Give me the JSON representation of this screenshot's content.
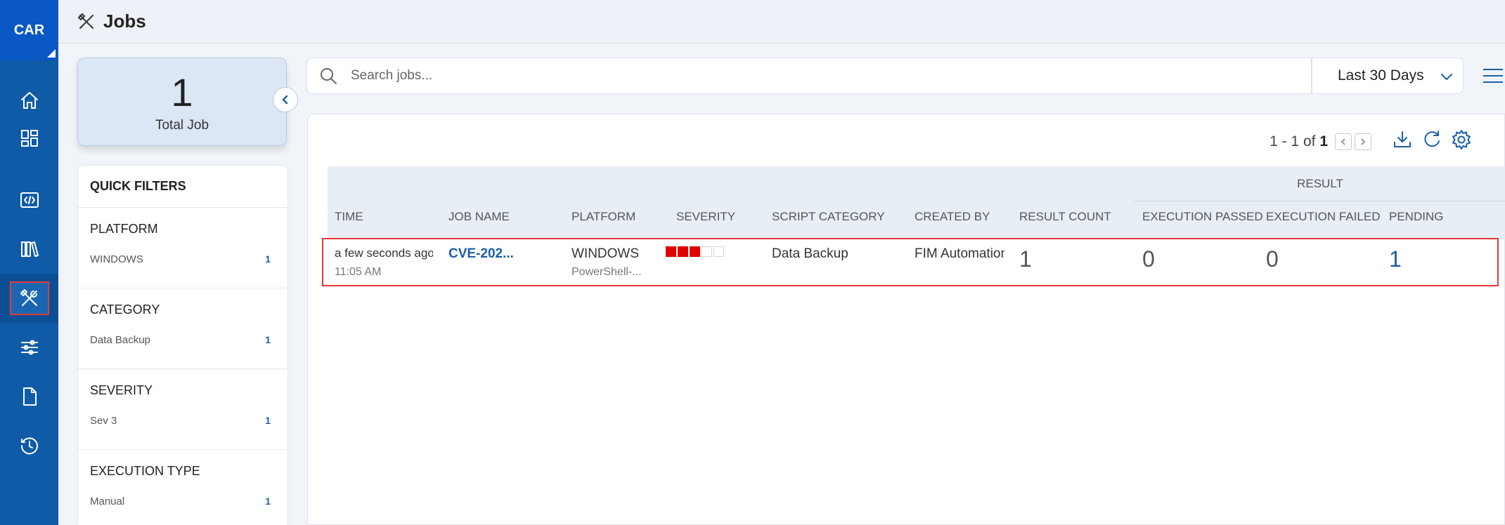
{
  "app": {
    "brand": "CAR"
  },
  "header": {
    "title": "Jobs"
  },
  "sidebar": {
    "items": [
      {
        "name": "home-icon"
      },
      {
        "name": "dashboard-icon"
      },
      {
        "name": "code-icon"
      },
      {
        "name": "library-icon"
      },
      {
        "name": "tools-icon",
        "active": true
      },
      {
        "name": "sliders-icon"
      },
      {
        "name": "document-icon"
      },
      {
        "name": "history-icon"
      }
    ]
  },
  "summary": {
    "count": "1",
    "label": "Total Job"
  },
  "search": {
    "placeholder": "Search jobs...",
    "value": ""
  },
  "date_range": {
    "value": "Last 30 Days"
  },
  "quick_filters": {
    "title": "QUICK FILTERS",
    "groups": [
      {
        "title": "PLATFORM",
        "option": "WINDOWS",
        "count": "1"
      },
      {
        "title": "CATEGORY",
        "option": "Data Backup",
        "count": "1"
      },
      {
        "title": "SEVERITY",
        "option": "Sev 3",
        "count": "1"
      },
      {
        "title": "EXECUTION TYPE",
        "option": "Manual",
        "count": "1"
      }
    ]
  },
  "pager": {
    "range": "1 - 1 of",
    "total": "1"
  },
  "table": {
    "group_header": "RESULT",
    "columns": [
      "TIME",
      "JOB NAME",
      "PLATFORM",
      "SEVERITY",
      "SCRIPT CATEGORY",
      "CREATED BY",
      "RESULT COUNT",
      "EXECUTION PASSED",
      "EXECUTION FAILED",
      "PENDING"
    ],
    "rows": [
      {
        "time": "a few seconds ago",
        "time_sub": "11:05 AM",
        "job_name": "CVE-202...",
        "platform": "WINDOWS",
        "platform_sub": "PowerShell-...",
        "severity_level": 3,
        "severity_max": 5,
        "script_category": "Data Backup",
        "created_by": "FIM Automation",
        "result_count": "1",
        "execution_passed": "0",
        "execution_failed": "0",
        "pending": "1"
      }
    ]
  },
  "colors": {
    "accent": "#1a5fa8",
    "sidebar": "#0f5ba8",
    "severity": "#e00000",
    "highlight": "#e53935"
  }
}
